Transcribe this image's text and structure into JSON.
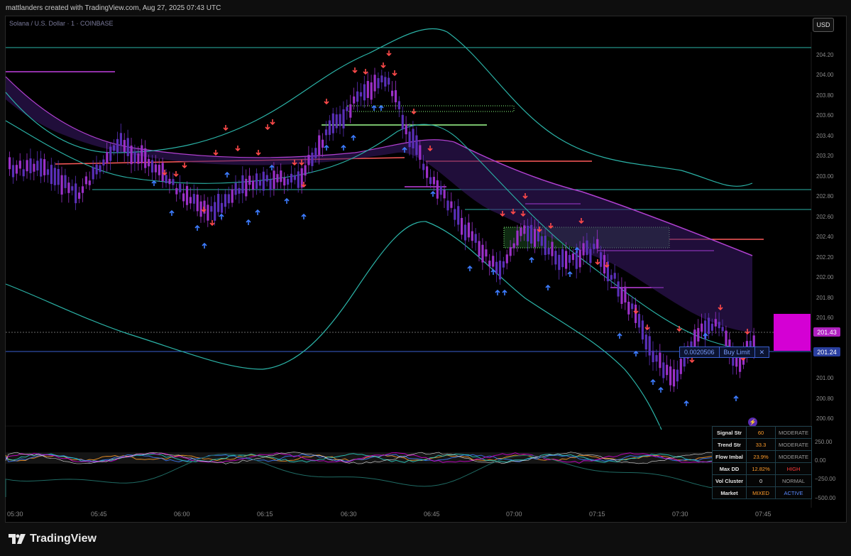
{
  "header": {
    "attribution": "mattlanders created with TradingView.com, Aug 27, 2025 07:43 UTC"
  },
  "chart": {
    "symbol_title": "Solana / U.S. Dollar · 1 · COINBASE",
    "currency": "USD",
    "price_axis": [
      "204.20",
      "204.00",
      "203.80",
      "203.60",
      "203.40",
      "203.20",
      "203.00",
      "202.80",
      "202.60",
      "202.40",
      "202.20",
      "202.00",
      "201.80",
      "201.60",
      "201.00",
      "200.80",
      "200.60"
    ],
    "osc_axis": [
      "250.00",
      "0.00",
      "−250.00",
      "−500.00"
    ],
    "time_axis": [
      "05:30",
      "05:45",
      "06:00",
      "06:15",
      "06:30",
      "06:45",
      "07:00",
      "07:15",
      "07:30",
      "07:45"
    ],
    "last_price_badge": "201.43",
    "order_price_badge": "201.24",
    "order_ticket": {
      "qty": "0.0020506",
      "type": "Buy Limit",
      "close": "✕"
    },
    "colors": {
      "up": "#9b30c8",
      "down": "#5a2fb8",
      "buy_arrow": "#3d7cff",
      "sell_arrow": "#ff4a4a",
      "band": "#2bb3a7",
      "magenta": "#d400d4"
    }
  },
  "signal_table": {
    "rows": [
      {
        "label": "Signal Str",
        "value": "60",
        "status": "MODERATE",
        "value_color": "#ff9c2a",
        "status_color": "#9a9a9a"
      },
      {
        "label": "Trend Str",
        "value": "33.3",
        "status": "MODERATE",
        "value_color": "#ff9c2a",
        "status_color": "#9a9a9a"
      },
      {
        "label": "Flow Imbal",
        "value": "23.9%",
        "status": "MODERATE",
        "value_color": "#ff9c2a",
        "status_color": "#9a9a9a"
      },
      {
        "label": "Max DD",
        "value": "12.82%",
        "status": "HIGH",
        "value_color": "#ff9c2a",
        "status_color": "#ff3a3a"
      },
      {
        "label": "Vol Cluster",
        "value": "0",
        "status": "NORMAL",
        "value_color": "#e6e6e6",
        "status_color": "#9a9a9a"
      },
      {
        "label": "Market",
        "value": "MIXED",
        "status": "ACTIVE",
        "value_color": "#ff9c2a",
        "status_color": "#5a8aff"
      }
    ]
  },
  "footer": {
    "brand": "TradingView"
  }
}
